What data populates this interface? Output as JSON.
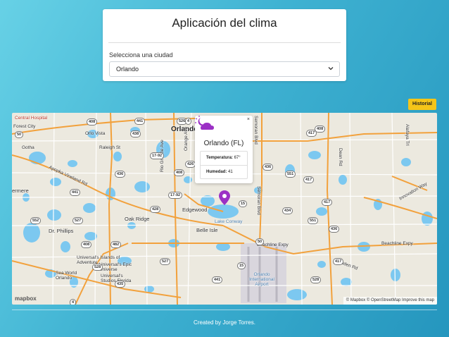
{
  "app": {
    "title": "Aplicación del clima",
    "select_label": "Selecciona una ciudad",
    "selected_city": "Orlando",
    "historial_button": "Historial"
  },
  "popup": {
    "close": "×",
    "city": "Orlando (FL)",
    "temperature_label": "Temperatura:",
    "temperature_value": "67°",
    "humidity_label": "Humedad:",
    "humidity_value": "41"
  },
  "map": {
    "labels": {
      "central_hospital": "Central Hospital",
      "orlo_vista": "Orlo Vista",
      "raleigh_st": "Raleigh St",
      "gotha": "Gotha",
      "orlando": "Orlando",
      "ermere": "ermere",
      "oak_ridge": "Oak Ridge",
      "edgewood": "Edgewood",
      "belle_isle": "Belle Isle",
      "lake_conway": "Lake Conway",
      "dr_phillips": "Dr. Phillips",
      "universal_islands": "Universal's Islands of Adventure",
      "universal_epic": "Universal's Epic Universe",
      "sea_world": "Sea World Orlando",
      "universal_studios": "Universal's Studios Florida",
      "beachline_expy_1": "Beachline Expy",
      "beachline_expy_2": "Beachline Expy",
      "airport": "Orlando International Airport",
      "semoran_blvd_1": "Semoran Blvd",
      "semoran_blvd_2": "Semoran Blvd",
      "orange_ave": "Orange Ave",
      "rio_grande_ave": "Rio Grande Ave",
      "dean_rd": "Dean Rd",
      "alafaya_trl": "Alafaya Trl",
      "dowden_rd": "Dowden Rd",
      "innovation_way": "Innovation Way",
      "apopka_vineland": "Apopka Vineland Rd",
      "forest_city": "Forest City"
    },
    "shields": [
      "408",
      "441",
      "526",
      "4",
      "50",
      "417",
      "408",
      "438",
      "527",
      "438",
      "15",
      "426",
      "17-92",
      "436",
      "551",
      "408",
      "417",
      "15",
      "434",
      "551",
      "436",
      "417",
      "441",
      "408",
      "482",
      "528",
      "527",
      "417",
      "528",
      "435",
      "441",
      "552",
      "50",
      "17-92",
      "436",
      "527",
      "4",
      "15",
      "428"
    ],
    "attribution": "© Mapbox © OpenStreetMap  Improve this map",
    "logo": "mapbox"
  },
  "footer": {
    "text": "Created by Jorge Torres."
  },
  "colors": {
    "accent": "#f5c518",
    "marker": "#9b30c5",
    "water": "#7cc8f0",
    "highway": "#f2a13c",
    "road": "#ffffff"
  }
}
